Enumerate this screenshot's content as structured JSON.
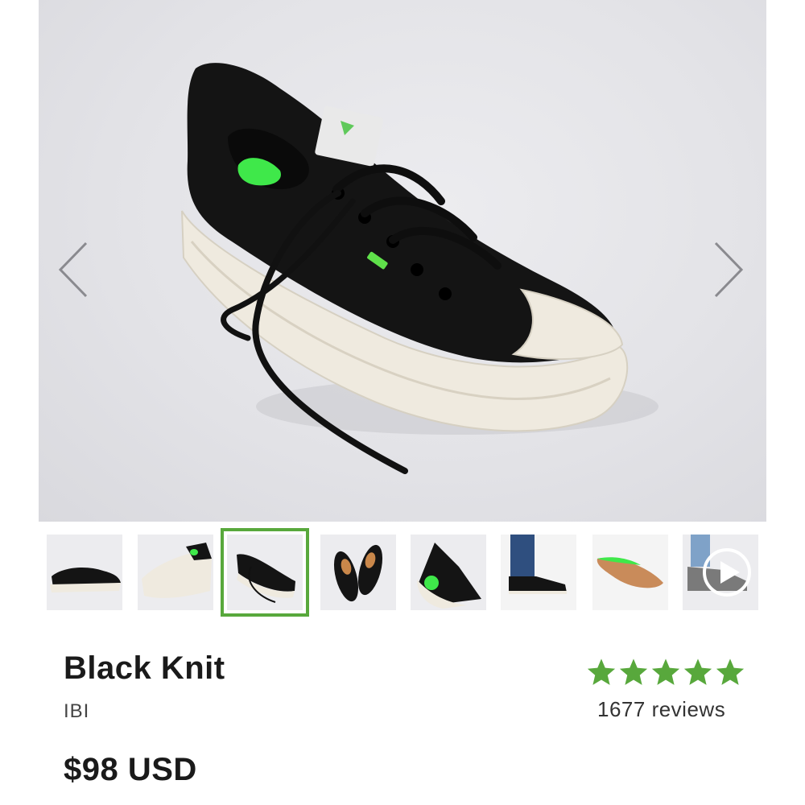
{
  "product": {
    "name": "Black Knit",
    "model": "IBI",
    "price": "$98 USD",
    "reviews_label": "1677 reviews",
    "rating": 5,
    "rating_max": 5,
    "accent_color": "#58a83c"
  },
  "gallery": {
    "active_index": 2,
    "thumbnails": [
      {
        "name": "side-view"
      },
      {
        "name": "heel-view"
      },
      {
        "name": "angled-view"
      },
      {
        "name": "top-pair-view"
      },
      {
        "name": "back-sole-view"
      },
      {
        "name": "on-foot-view"
      },
      {
        "name": "insole-view"
      },
      {
        "name": "video-view",
        "icon": "play-icon"
      }
    ],
    "prev_icon": "chevron-left-icon",
    "next_icon": "chevron-right-icon"
  }
}
